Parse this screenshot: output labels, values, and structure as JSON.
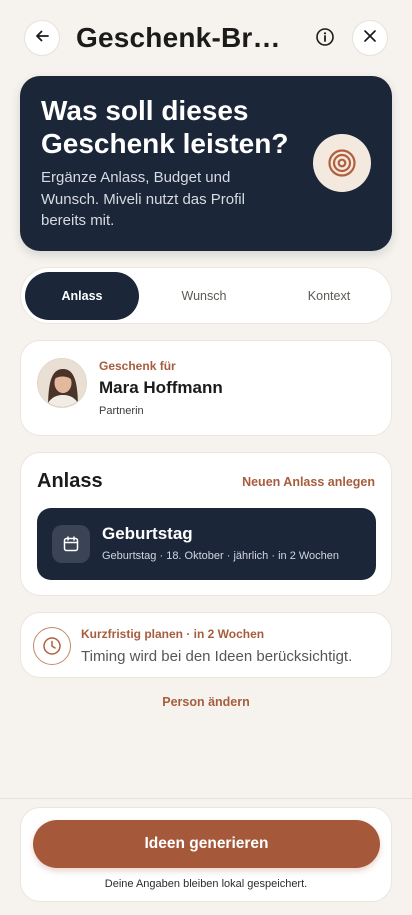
{
  "header": {
    "title": "Geschenk-Bri…",
    "icons": {
      "back": "arrow-left-icon",
      "info": "info-icon",
      "close": "close-icon"
    }
  },
  "hero": {
    "title": "Was soll dieses Geschenk leisten?",
    "subtitle": "Ergänze Anlass, Budget und Wunsch. Miveli nutzt das Profil bereits mit.",
    "icon": "target-icon"
  },
  "tabs": [
    {
      "label": "Anlass",
      "active": true
    },
    {
      "label": "Wunsch",
      "active": false
    },
    {
      "label": "Kontext",
      "active": false
    }
  ],
  "recipient": {
    "eyebrow": "Geschenk für",
    "name": "Mara Hoffmann",
    "relation": "Partnerin"
  },
  "occasion": {
    "heading": "Anlass",
    "new_link": "Neuen Anlass anlegen",
    "item": {
      "title": "Geburtstag",
      "meta": "Geburtstag · 18. Oktober · jährlich · in 2 Wochen",
      "icon": "calendar-icon"
    }
  },
  "timing": {
    "eyebrow": "Kurzfristig planen · in 2 Wochen",
    "text": "Timing wird bei den Ideen berücksichtigt.",
    "icon": "clock-icon"
  },
  "change_person": "Person ändern",
  "footer": {
    "cta": "Ideen generieren",
    "note": "Deine Angaben bleiben lokal gespeichert."
  },
  "colors": {
    "navy": "#1b2638",
    "accent": "#a5593a",
    "background": "#f6f3ee"
  }
}
